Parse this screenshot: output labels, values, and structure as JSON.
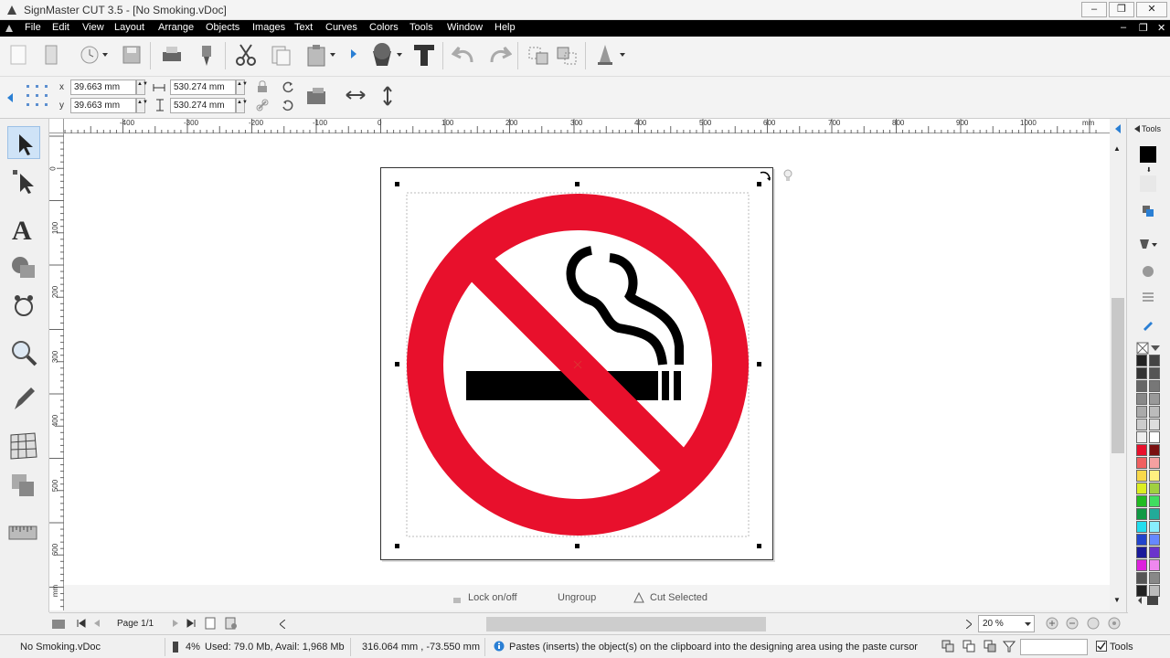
{
  "window": {
    "title": "SignMaster CUT 3.5 - [No Smoking.vDoc]",
    "minimize": "–",
    "restore": "❐",
    "close": "✕",
    "doc_min": "–",
    "doc_restore": "❐",
    "doc_close": "✕"
  },
  "menu": [
    "File",
    "Edit",
    "View",
    "Layout",
    "Arrange",
    "Objects",
    "Images",
    "Text",
    "Curves",
    "Colors",
    "Tools",
    "Window",
    "Help"
  ],
  "props": {
    "x_label": "x",
    "y_label": "y",
    "x_value": "39.663 mm",
    "y_value": "39.663 mm",
    "w_value": "530.274 mm",
    "h_value": "530.274 mm"
  },
  "ruler": {
    "h_labels": [
      "-400",
      "-300",
      "-200",
      "-100",
      "0",
      "100",
      "200",
      "300",
      "400",
      "500",
      "600",
      "700",
      "800",
      "900",
      "1000",
      "mm"
    ],
    "v_labels": [
      "0",
      "100",
      "200",
      "300",
      "400",
      "500",
      "600",
      "mm"
    ]
  },
  "hints": {
    "lock": "Lock on/off",
    "ungroup": "Ungroup",
    "cut_selected": "Cut Selected"
  },
  "right_panel": {
    "title": "Tools"
  },
  "palette": [
    "#222222",
    "#444444",
    "#333333",
    "#555555",
    "#666666",
    "#777777",
    "#888888",
    "#999999",
    "#aaaaaa",
    "#bbbbbb",
    "#cccccc",
    "#dddddd",
    "#eeeeee",
    "#ffffff",
    "#e8102c",
    "#7a1010",
    "#f06060",
    "#f4a0a0",
    "#f9d84a",
    "#fff080",
    "#ddee22",
    "#a0d040",
    "#22bb22",
    "#40dd60",
    "#119944",
    "#22aa99",
    "#22ddee",
    "#88eeff",
    "#2244cc",
    "#6688ff",
    "#1a1a99",
    "#6a33cc",
    "#dd22dd",
    "#ee88ee",
    "#555555",
    "#888888",
    "#222222",
    "#bbbbbb"
  ],
  "nav": {
    "page": "Page 1/1",
    "zoom": "20 %"
  },
  "status": {
    "doc": "No Smoking.vDoc",
    "percent": "4%",
    "memory": "Used: 79.0 Mb, Avail: 1,968 Mb",
    "coords": "316.064 mm , -73.550 mm",
    "message": "Pastes (inserts) the object(s) on the clipboard into the designing area using the paste cursor",
    "tools": "Tools"
  }
}
